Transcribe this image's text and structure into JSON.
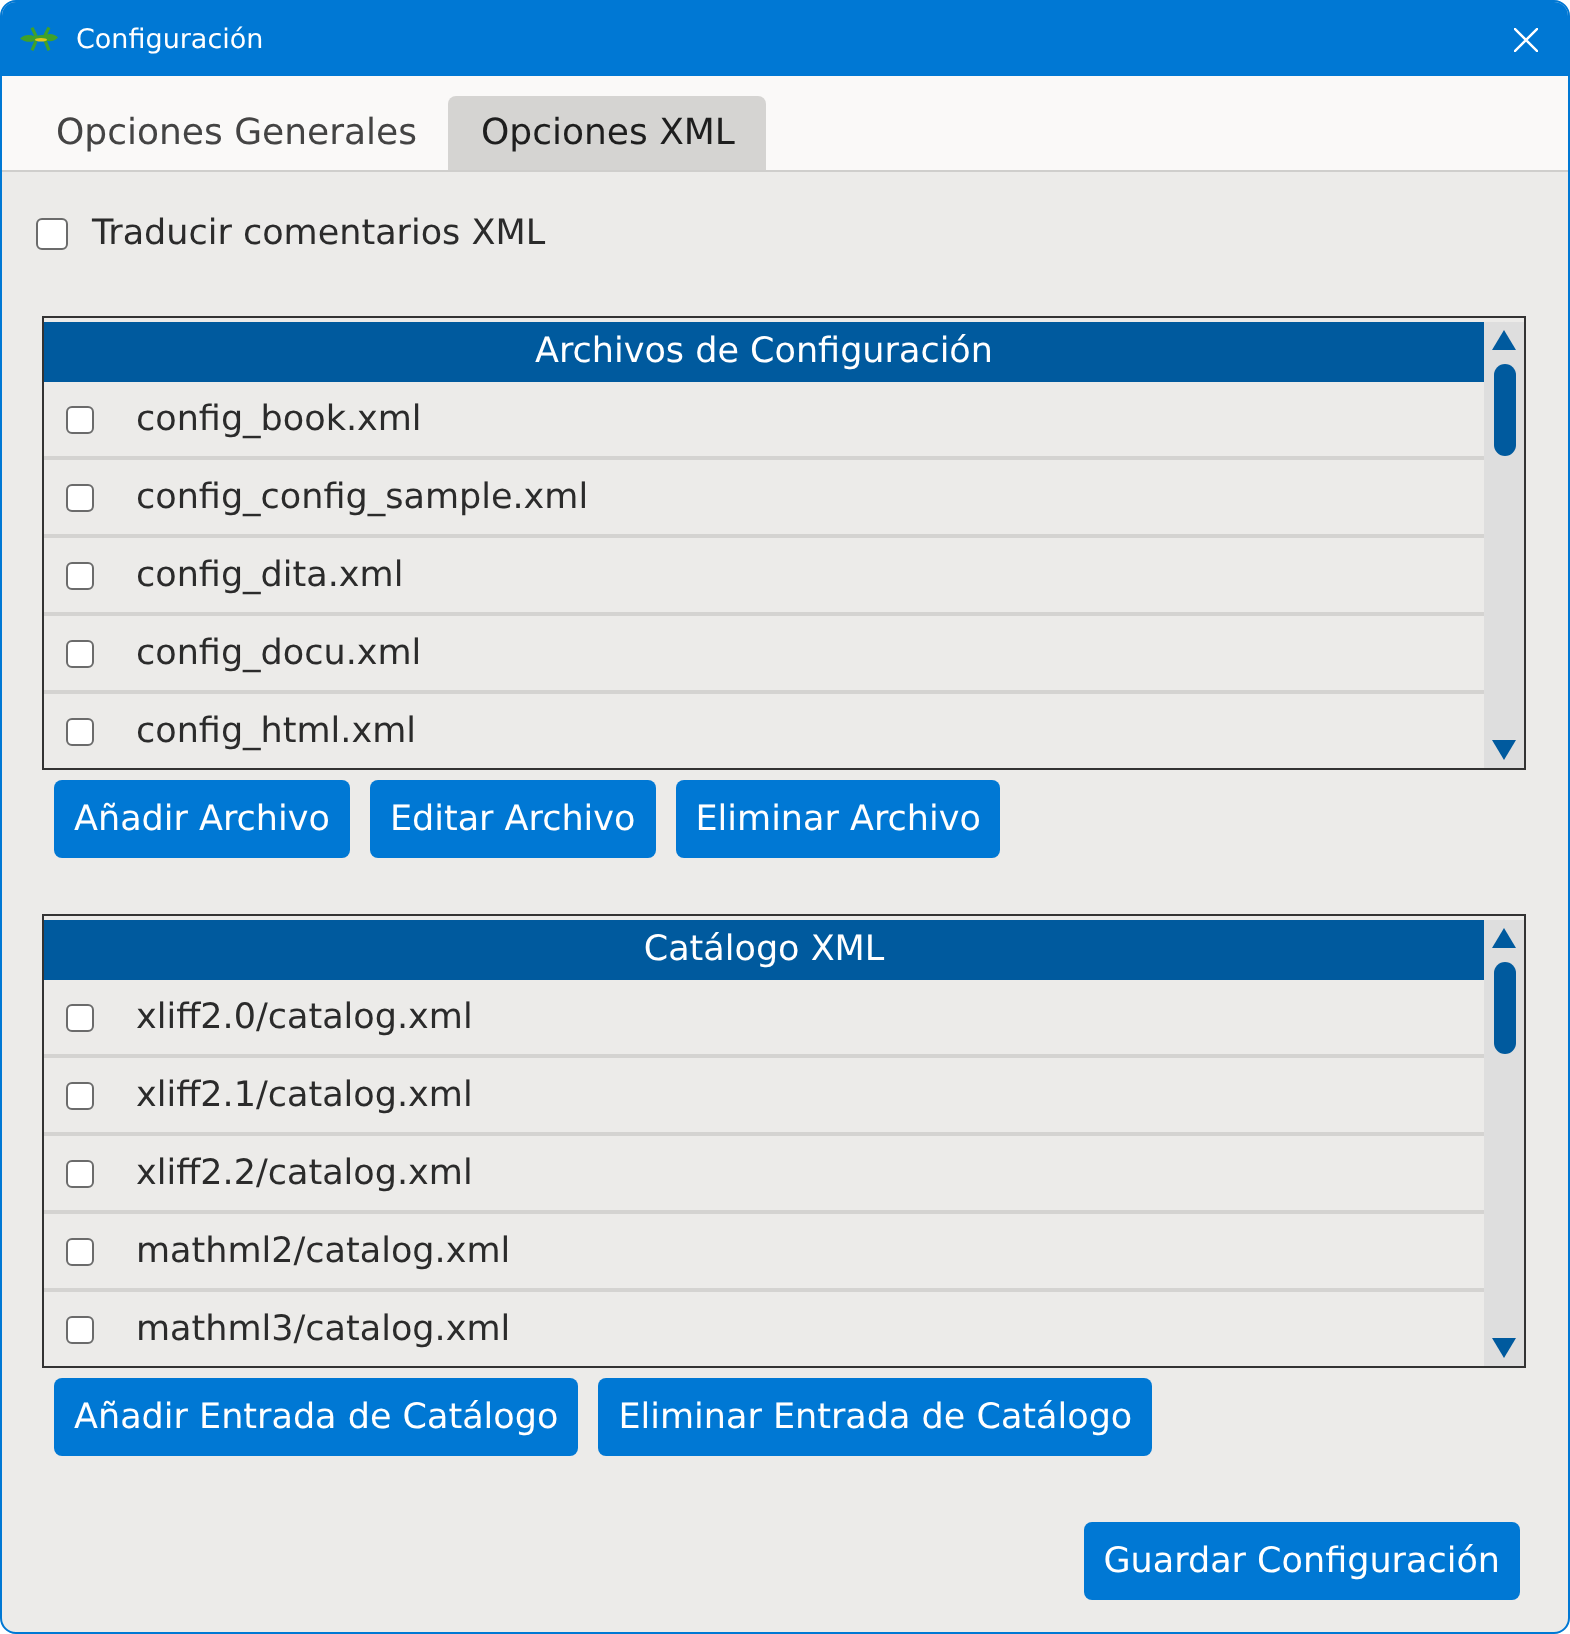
{
  "window": {
    "title": "Configuración"
  },
  "tabs": [
    {
      "label": "Opciones Generales",
      "selected": false
    },
    {
      "label": "Opciones XML",
      "selected": true
    }
  ],
  "translate_xml_comments": {
    "label": "Traducir comentarios XML",
    "checked": false
  },
  "config_files": {
    "header": "Archivos de Configuración",
    "rows": [
      {
        "name": "config_book.xml",
        "checked": false
      },
      {
        "name": "config_config_sample.xml",
        "checked": false
      },
      {
        "name": "config_dita.xml",
        "checked": false
      },
      {
        "name": "config_docu.xml",
        "checked": false
      },
      {
        "name": "config_html.xml",
        "checked": false
      }
    ],
    "buttons": [
      "Añadir Archivo",
      "Editar Archivo",
      "Eliminar Archivo"
    ]
  },
  "xml_catalog": {
    "header": "Catálogo XML",
    "rows": [
      {
        "name": "xliff2.0/catalog.xml",
        "checked": false
      },
      {
        "name": "xliff2.1/catalog.xml",
        "checked": false
      },
      {
        "name": "xliff2.2/catalog.xml",
        "checked": false
      },
      {
        "name": "mathml2/catalog.xml",
        "checked": false
      },
      {
        "name": "mathml3/catalog.xml",
        "checked": false
      }
    ],
    "buttons": [
      "Añadir Entrada de Catálogo",
      "Eliminar Entrada de Catálogo"
    ]
  },
  "save_button": "Guardar Configuración"
}
